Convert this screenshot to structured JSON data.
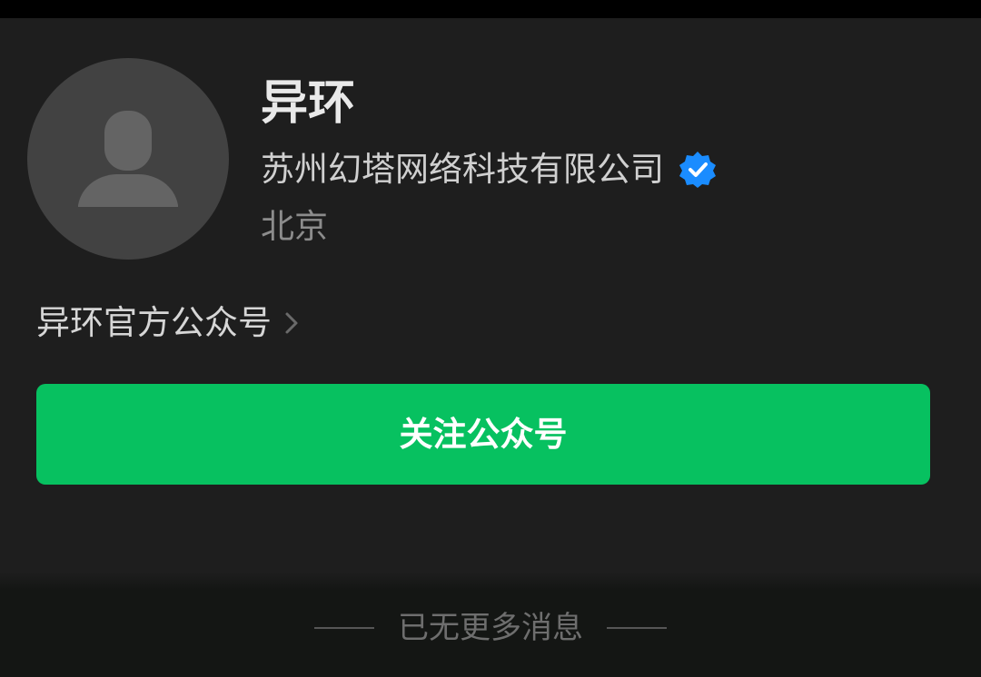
{
  "profile": {
    "name": "异环",
    "company": "苏州幻塔网络科技有限公司",
    "location": "北京",
    "avatar_icon": "default-person-icon",
    "verified_icon": "verified-badge-icon",
    "verified_color": "#1a8cff"
  },
  "official_account": {
    "label": "异环官方公众号",
    "chevron_icon": "chevron-right-icon"
  },
  "follow_button": {
    "label": "关注公众号",
    "color": "#07c160"
  },
  "footer": {
    "no_more_text": "已无更多消息"
  }
}
